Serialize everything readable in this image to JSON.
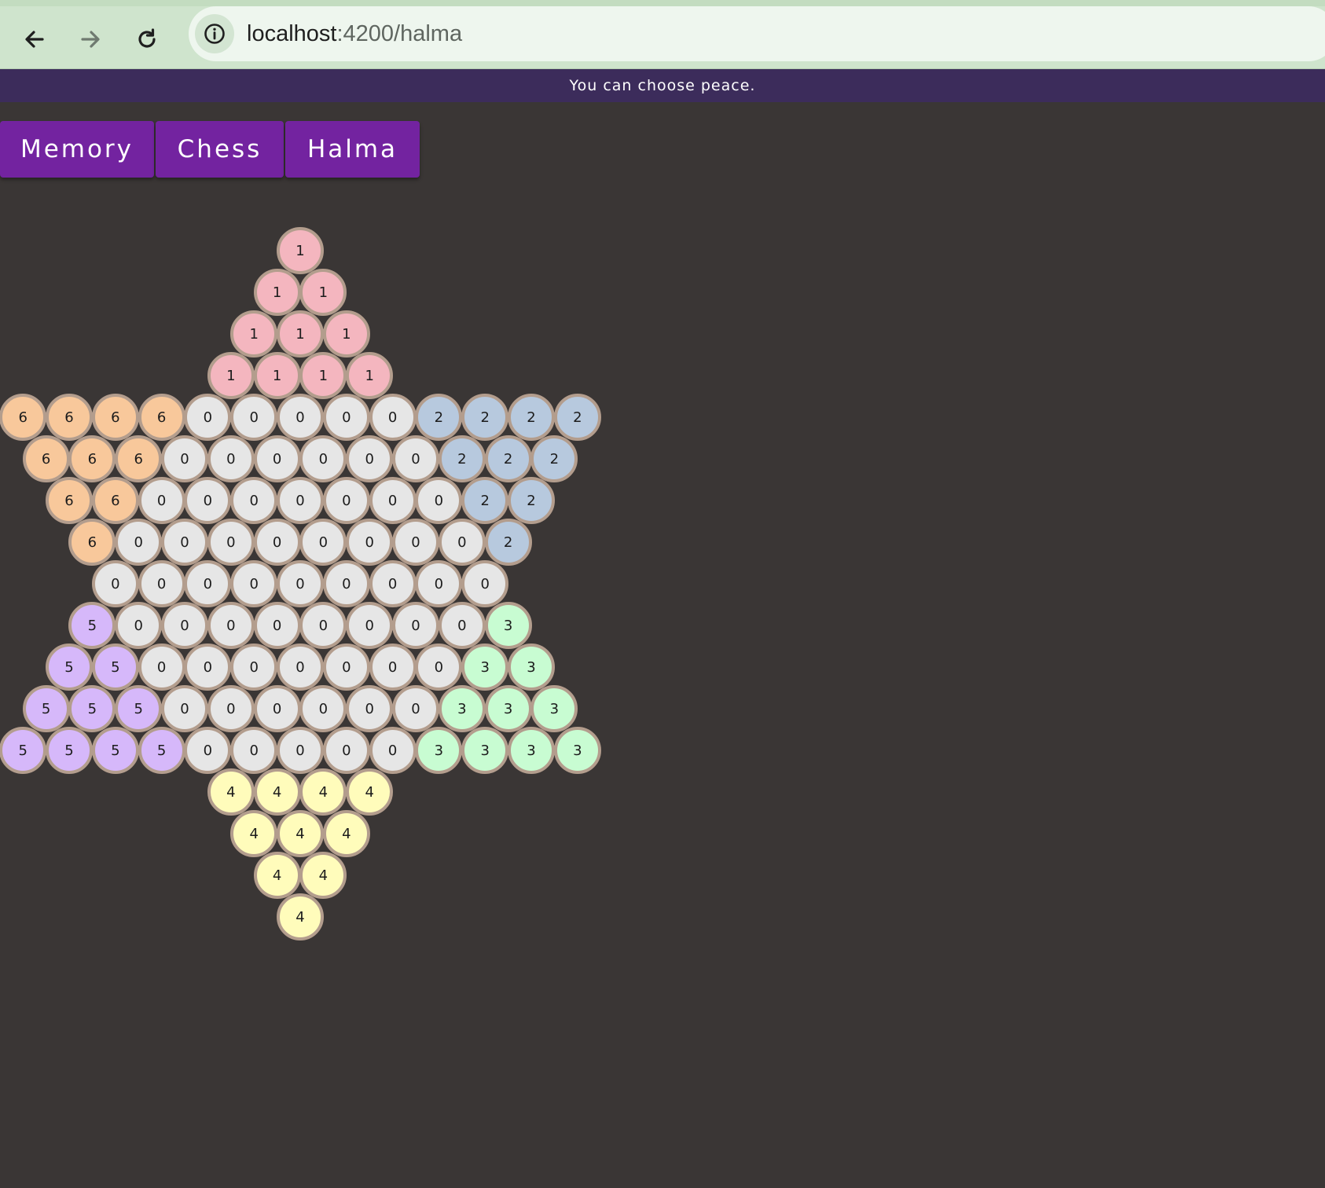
{
  "browser": {
    "url_host": "localhost",
    "url_path": ":4200/halma"
  },
  "banner": {
    "text": "You can choose peace."
  },
  "tabs": [
    {
      "label": "Memory"
    },
    {
      "label": "Chess"
    },
    {
      "label": "Halma"
    }
  ],
  "colors": {
    "0": "#e6e6e6",
    "1": "#f4b6bf",
    "2": "#b7c9de",
    "3": "#c8fcd2",
    "4": "#fffcbb",
    "5": "#d6b8fa",
    "6": "#f8c89b",
    "rim": "#b39d8d",
    "tab": "#7323a0",
    "banner": "#3c2c5b",
    "background": "#3a3635"
  },
  "board": {
    "rows": [
      [
        "1"
      ],
      [
        "1",
        "1"
      ],
      [
        "1",
        "1",
        "1"
      ],
      [
        "1",
        "1",
        "1",
        "1"
      ],
      [
        "6",
        "6",
        "6",
        "6",
        "0",
        "0",
        "0",
        "0",
        "0",
        "2",
        "2",
        "2",
        "2"
      ],
      [
        "6",
        "6",
        "6",
        "0",
        "0",
        "0",
        "0",
        "0",
        "0",
        "2",
        "2",
        "2"
      ],
      [
        "6",
        "6",
        "0",
        "0",
        "0",
        "0",
        "0",
        "0",
        "0",
        "2",
        "2"
      ],
      [
        "6",
        "0",
        "0",
        "0",
        "0",
        "0",
        "0",
        "0",
        "0",
        "2"
      ],
      [
        "0",
        "0",
        "0",
        "0",
        "0",
        "0",
        "0",
        "0",
        "0"
      ],
      [
        "5",
        "0",
        "0",
        "0",
        "0",
        "0",
        "0",
        "0",
        "0",
        "3"
      ],
      [
        "5",
        "5",
        "0",
        "0",
        "0",
        "0",
        "0",
        "0",
        "0",
        "3",
        "3"
      ],
      [
        "5",
        "5",
        "5",
        "0",
        "0",
        "0",
        "0",
        "0",
        "0",
        "3",
        "3",
        "3"
      ],
      [
        "5",
        "5",
        "5",
        "5",
        "0",
        "0",
        "0",
        "0",
        "0",
        "3",
        "3",
        "3",
        "3"
      ],
      [
        "4",
        "4",
        "4",
        "4"
      ],
      [
        "4",
        "4",
        "4"
      ],
      [
        "4",
        "4"
      ],
      [
        "4"
      ]
    ]
  }
}
